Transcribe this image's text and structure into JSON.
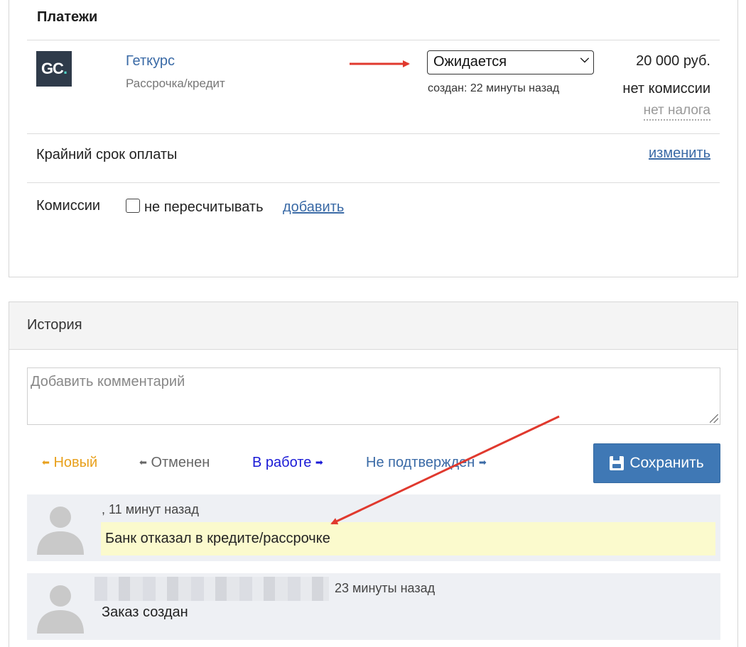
{
  "payments": {
    "title": "Платежи",
    "provider": {
      "logo_text": "GC",
      "logo_dot": ".",
      "name": "Геткурс",
      "type": "Рассрочка/кредит"
    },
    "status_select": {
      "value": "Ожидается"
    },
    "created": "создан: 22 минуты назад",
    "amount": "20 000 руб.",
    "commission": "нет комиссии",
    "tax": "нет налога",
    "deadline": {
      "label": "Крайний срок оплаты",
      "action": "изменить"
    },
    "commissions": {
      "label": "Комиссии",
      "checkbox_label": "не пересчитывать",
      "add": "добавить"
    }
  },
  "history": {
    "title": "История",
    "comment_placeholder": "Добавить комментарий",
    "status_buttons": [
      {
        "label": "Новый",
        "arrow": "left"
      },
      {
        "label": "Отменен",
        "arrow": "left"
      },
      {
        "label": "В работе",
        "arrow": "right"
      },
      {
        "label": "Не подтвержден",
        "arrow": "right"
      }
    ],
    "save_label": "Сохранить",
    "entries": [
      {
        "meta": ", 11 минут назад",
        "text": "Банк отказал в кредите/рассрочке",
        "highlight": true
      },
      {
        "meta": "23 минуты назад",
        "text": "Заказ создан",
        "highlight": false
      }
    ]
  },
  "colors": {
    "link": "#3a6aa6",
    "accent_button": "#3f78b5",
    "status_new": "#e8a01c",
    "status_in_work": "#1a1ad6",
    "annotation_arrow": "#e0392e",
    "highlight_bg": "#fbfacd"
  }
}
